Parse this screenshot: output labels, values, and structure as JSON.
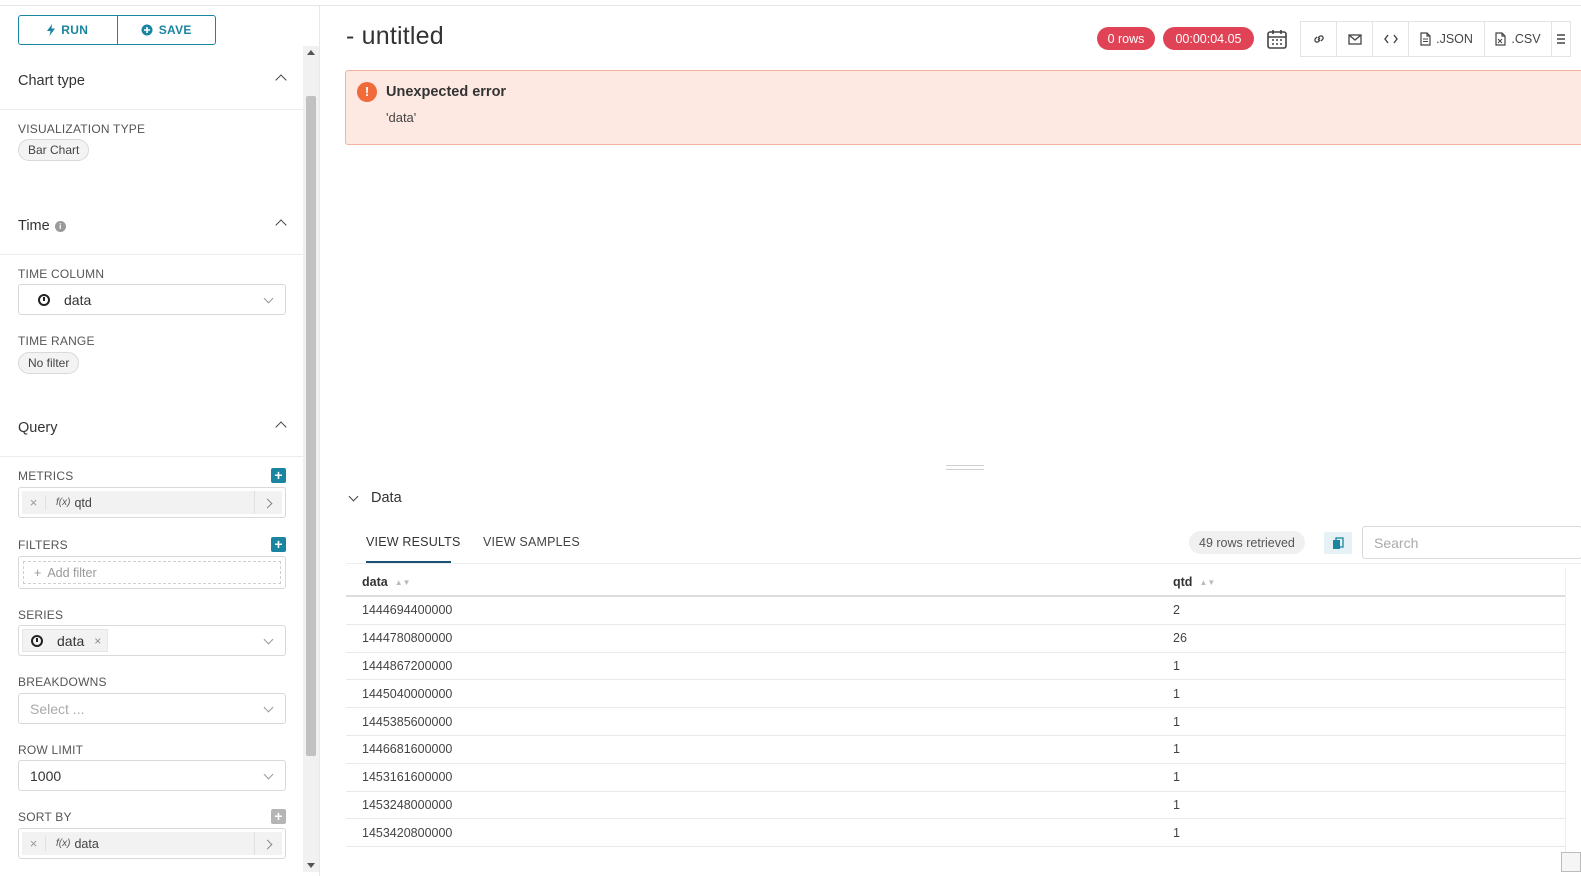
{
  "actions": {
    "run_label": "RUN",
    "save_label": "SAVE"
  },
  "sections": {
    "chart_type": {
      "title": "Chart type",
      "viz_label": "VISUALIZATION TYPE",
      "viz_value": "Bar Chart"
    },
    "time": {
      "title": "Time",
      "time_column_label": "TIME COLUMN",
      "time_column_value": "data",
      "time_range_label": "TIME RANGE",
      "time_range_value": "No filter"
    },
    "query": {
      "title": "Query",
      "metrics_label": "METRICS",
      "metric_value": "qtd",
      "metric_fx": "f(x)",
      "filters_label": "FILTERS",
      "add_filter": "Add filter",
      "series_label": "SERIES",
      "series_value": "data",
      "breakdowns_label": "BREAKDOWNS",
      "breakdowns_placeholder": "Select ...",
      "row_limit_label": "ROW LIMIT",
      "row_limit_value": "1000",
      "sort_by_label": "SORT BY",
      "sort_by_value": "data",
      "sort_fx": "f(x)"
    }
  },
  "header": {
    "title": "- untitled",
    "rows_badge": "0 rows",
    "timer_badge": "00:00:04.05",
    "json_label": ".JSON",
    "csv_label": ".CSV",
    "badge_color": "#e04355"
  },
  "alert": {
    "title": "Unexpected error",
    "message": "'data'"
  },
  "data_panel": {
    "toggle_label": "Data",
    "tabs": [
      "VIEW RESULTS",
      "VIEW SAMPLES"
    ],
    "rows_retrieved": "49 rows retrieved",
    "search_placeholder": "Search",
    "columns": [
      "data",
      "qtd"
    ],
    "rows": [
      [
        "1444694400000",
        "2"
      ],
      [
        "1444780800000",
        "26"
      ],
      [
        "1444867200000",
        "1"
      ],
      [
        "1445040000000",
        "1"
      ],
      [
        "1445385600000",
        "1"
      ],
      [
        "1446681600000",
        "1"
      ],
      [
        "1453161600000",
        "1"
      ],
      [
        "1453248000000",
        "1"
      ],
      [
        "1453420800000",
        "1"
      ]
    ]
  },
  "colors": {
    "accent": "#1a85a0",
    "error_bg": "#fde9e2",
    "error_icon": "#f06a3a"
  }
}
